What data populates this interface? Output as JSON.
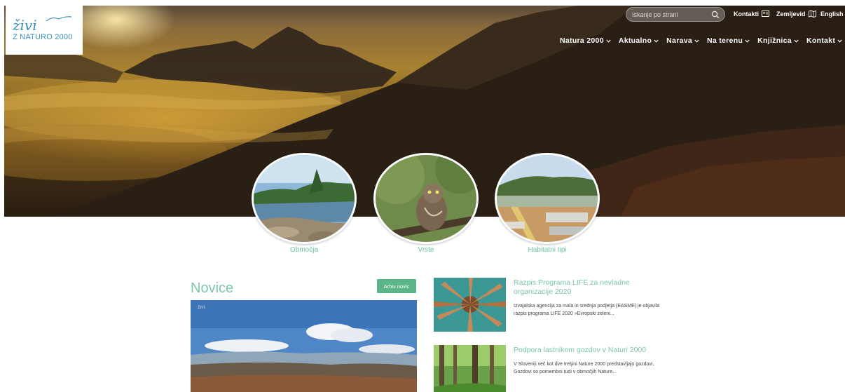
{
  "logo": {
    "script": "živi",
    "subtitle": "Z NATURO 2000"
  },
  "search": {
    "placeholder": "Iskanje po strani"
  },
  "utility_nav": {
    "contacts": "Kontakti",
    "map": "Zemljevid",
    "language": "English"
  },
  "main_nav": [
    "Natura 2000",
    "Aktualno",
    "Narava",
    "Na terenu",
    "Knjižnica",
    "Kontakt"
  ],
  "categories": [
    "Območja",
    "Vrste",
    "Habitatni tipi"
  ],
  "news": {
    "heading": "Novice",
    "archive_label": "Arhiv novic",
    "items": [
      {
        "title": "Razpis Programa LIFE za nevladne organizacije 2020",
        "excerpt": "Izvajalska agencija za mala in srednja podjetja (EASME) je objavila razpis programa LIFE 2020 »Evropski zeleni..."
      },
      {
        "title": "Podpora lastnikom gozdov v Naturi 2000",
        "excerpt": "V Sloveniji več kot dve tretjini Nature 2000 predstavljajo gozdovi. Gozdovi so pomembni tudi v območjih Nature..."
      }
    ]
  },
  "colors": {
    "accent_green": "#7cc7a8",
    "button_green": "#5cb489",
    "logo_blue": "#3a8fb7"
  }
}
